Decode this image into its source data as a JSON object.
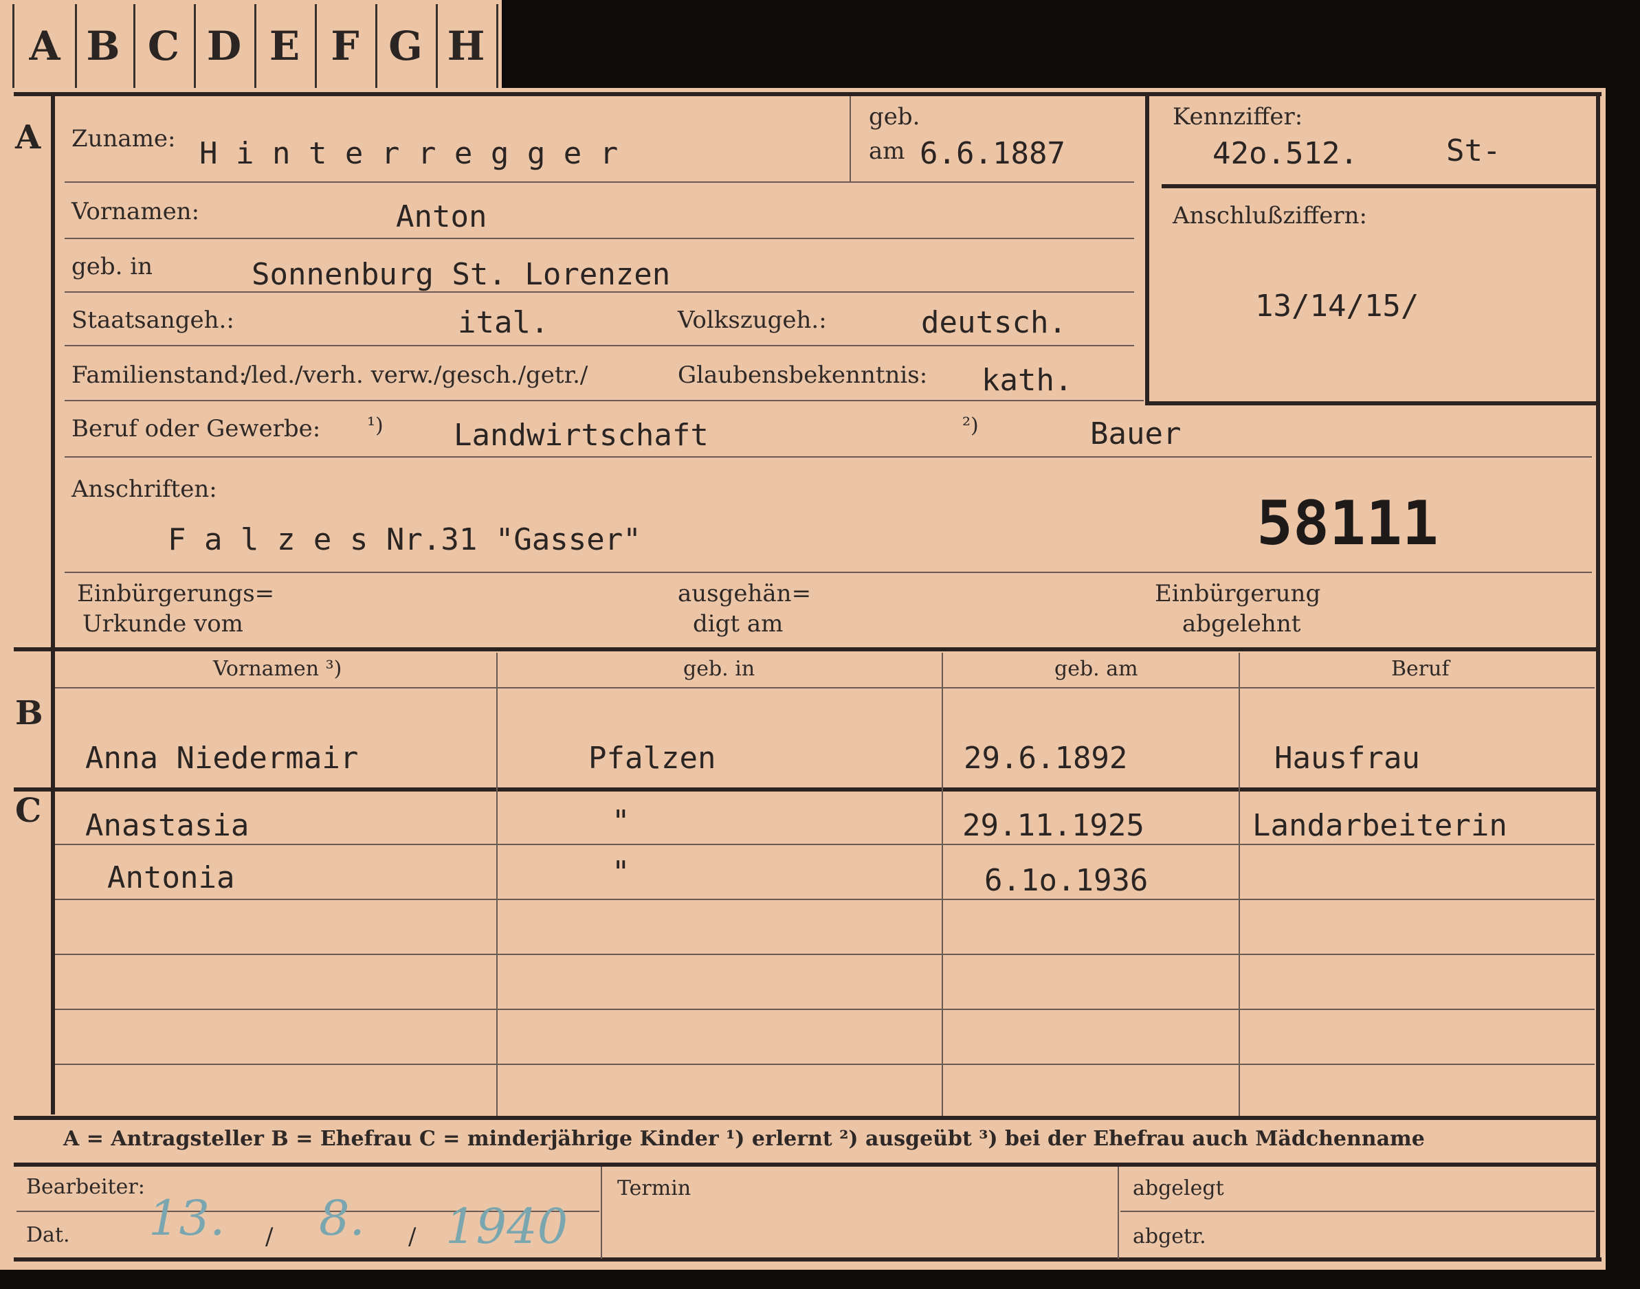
{
  "tabs": [
    "A",
    "B",
    "C",
    "D",
    "E",
    "F",
    "G",
    "H"
  ],
  "section_markers": {
    "a": "A",
    "b": "B",
    "c": "C"
  },
  "labels": {
    "zuname": "Zuname:",
    "geb": "geb.",
    "am": "am",
    "kennziffer": "Kennziffer:",
    "anschlussziffern": "Anschlußziffern:",
    "vornamen": "Vornamen:",
    "geb_in": "geb. in",
    "staatsangeh": "Staatsangeh.:",
    "volkszugeh": "Volkszugeh.:",
    "familienstand": "Familienstand:",
    "glaubensbekenntnis": "Glaubensbekenntnis:",
    "beruf": "Beruf oder Gewerbe:",
    "fn1": "¹)",
    "fn2": "²)",
    "anschriften": "Anschriften:",
    "einbuergerungs_1": "Einbürgerungs=",
    "einbuergerungs_2": "Urkunde vom",
    "ausgehaen_1": "ausgehän=",
    "ausgehaen_2": "digt am",
    "einbuergerung_1": "Einbürgerung",
    "einbuergerung_2": "abgelehnt",
    "bearbeiter": "Bearbeiter:",
    "dat": "Dat.",
    "termin": "Termin",
    "abgelegt": "abgelegt",
    "abgetr": "abgetr."
  },
  "values": {
    "zuname": "H i n t e r r e g g e r",
    "geb_am": "6.6.1887",
    "kennziffer": "42o.512.",
    "kennziffer_suffix": "St-",
    "anschlussziffern": "13/14/15/",
    "vornamen": "Anton",
    "geb_in": "Sonnenburg St. Lorenzen",
    "staatsangeh": "ital.",
    "volkszugeh": "deutsch.",
    "familienstand": "/led./verh. verw./gesch./getr./",
    "glaubensbekenntnis": "kath.",
    "beruf_erlernt": "Landwirtschaft",
    "beruf_ausgeuebt": "Bauer",
    "anschrift": "F a l z e s  Nr.31 \"Gasser\"",
    "card_number": "58111"
  },
  "family_table": {
    "headers": [
      "Vornamen ³)",
      "geb. in",
      "geb. am",
      "Beruf"
    ],
    "spouse": {
      "name": "Anna Niedermair",
      "geb_in": "Pfalzen",
      "geb_am": "29.6.1892",
      "beruf": "Hausfrau"
    },
    "children": [
      {
        "name": "Anastasia",
        "geb_in": "\"",
        "geb_am": "29.11.1925",
        "beruf": "Landarbeiterin"
      },
      {
        "name": "Antonia",
        "geb_in": "\"",
        "geb_am": "6.1o.1936",
        "beruf": ""
      }
    ]
  },
  "legend": "A = Antragsteller   B = Ehefrau   C = minderjährige Kinder   ¹) erlernt   ²) ausgeübt   ³) bei der Ehefrau auch Mädchenname",
  "footer": {
    "day": "13.",
    "month": "8.",
    "year": "1940",
    "sep": "/"
  }
}
